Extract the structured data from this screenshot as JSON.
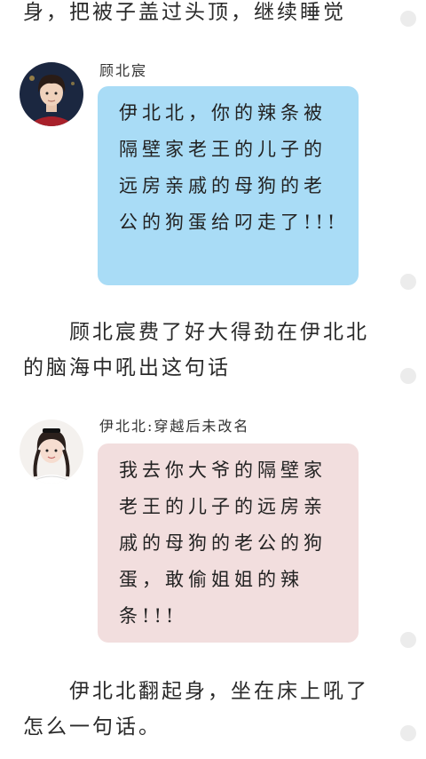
{
  "paragraphs": {
    "top": "身，把被子盖过头顶，继续睡觉",
    "middle": "　　顾北宸费了好大得劲在伊北北的脑海中吼出这句话",
    "bottom": "　　伊北北翻起身，坐在床上吼了怎么一句话。"
  },
  "messages": [
    {
      "speaker": "顾北宸",
      "text": "伊北北，你的辣条被隔壁家老王的儿子的远房亲戚的母狗的老公的狗蛋给叼走了!!!",
      "bubble_color": "#a9dcf6"
    },
    {
      "speaker": "伊北北:穿越后未改名",
      "text": "我去你大爷的隔壁家老王的儿子的远房亲戚的母狗的老公的狗蛋，敢偷姐姐的辣条!!!",
      "bubble_color": "#f2dede"
    }
  ],
  "colors": {
    "side_dot": "#ececec"
  }
}
